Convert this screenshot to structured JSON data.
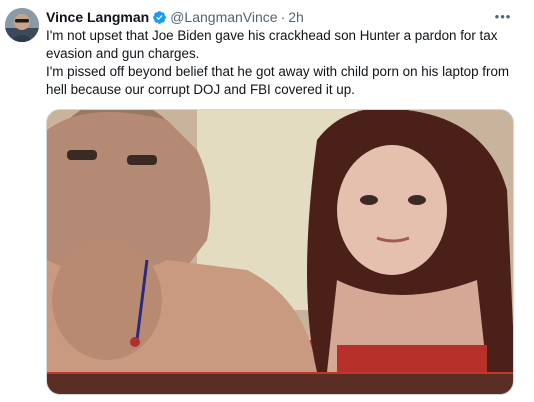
{
  "tweet": {
    "display_name": "Vince Langman",
    "handle": "@LangmanVince",
    "separator": "·",
    "time": "2h",
    "more_label": "•••",
    "text_lines": [
      "I'm not upset that Joe Biden gave his crackhead son Hunter a pardon for tax evasion and gun charges.",
      "I'm pissed off beyond belief that he got away with child porn on his laptop from hell because our corrupt DOJ and FBI covered it up."
    ]
  },
  "icons": {
    "verified": "verified-badge-icon",
    "more": "more-options-icon"
  },
  "colors": {
    "verified_blue": "#1d9bf0",
    "text": "#0f1419",
    "secondary_text": "#536471",
    "border": "#cfd9de"
  }
}
